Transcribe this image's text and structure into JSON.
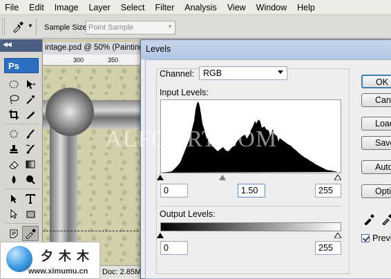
{
  "menubar": {
    "items": [
      "File",
      "Edit",
      "Image",
      "Layer",
      "Select",
      "Filter",
      "Analysis",
      "View",
      "Window",
      "Help"
    ]
  },
  "options_bar": {
    "tool_icon": "eyedropper-icon",
    "sample_size_label": "Sample Size:",
    "sample_size_value": "Point Sample"
  },
  "toolbox": {
    "header_glyph": "◀◀",
    "ps_label": "Ps"
  },
  "document": {
    "title": "intage.psd @ 50% (Painting",
    "ruler_labels": [
      "300",
      "350"
    ],
    "status_text": "Doc: 2.85M"
  },
  "levels_dialog": {
    "title": "Levels",
    "channel_label": "Channel:",
    "channel_value": "RGB",
    "input_levels_label": "Input Levels:",
    "input_black": "0",
    "input_gamma": "1.50",
    "input_white": "255",
    "output_levels_label": "Output Levels:",
    "output_black": "0",
    "output_white": "255",
    "buttons": {
      "ok": "OK",
      "cancel": "Cancel",
      "load": "Load...",
      "save": "Save...",
      "auto": "Auto",
      "options": "Options..."
    },
    "preview_label": "Preview",
    "preview_checked": true
  },
  "watermark": "ALFOART.COM",
  "logo": {
    "chinese": "夕木木",
    "url": "www.ximumu.cn"
  }
}
